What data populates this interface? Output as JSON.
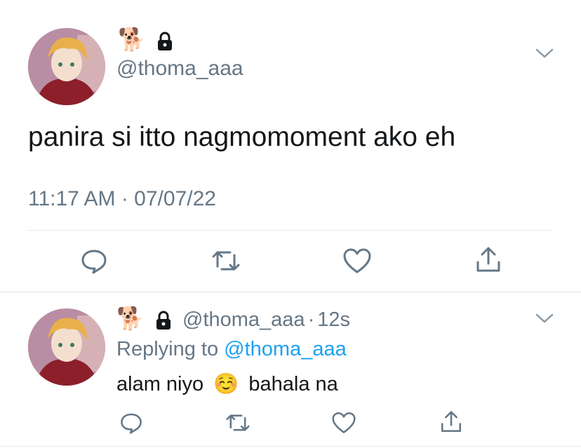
{
  "colors": {
    "text": "#14171a",
    "muted": "#657786",
    "link": "#1da1f2",
    "divider": "#e1e8ed"
  },
  "main_tweet": {
    "name_emoji": "🐕",
    "handle": "@thoma_aaa",
    "text": "panira si itto nagmomoment ako eh",
    "timestamp": "11:17 AM · 07/07/22"
  },
  "reply": {
    "name_emoji": "🐕",
    "handle": "@thoma_aaa",
    "separator": "·",
    "time_ago": "12s",
    "replying_prefix": "Replying to",
    "replying_handle": "@thoma_aaa",
    "text_before": "alam niyo",
    "emoji": "☺️",
    "text_after": "bahala na"
  },
  "icons": [
    "lock-icon",
    "chevron-down-icon",
    "reply-icon",
    "retweet-icon",
    "like-icon",
    "share-icon"
  ]
}
